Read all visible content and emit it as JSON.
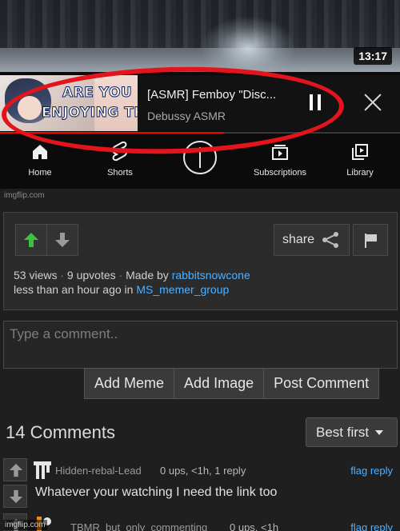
{
  "video": {
    "duration": "13:17"
  },
  "miniplayer": {
    "thumbnail_text_line1": "ARE YOU",
    "thumbnail_text_line2": "ENJOYING THIS?",
    "title": "[ASMR] Femboy \"Disc...",
    "channel": "Debussy ASMR",
    "progress_fraction": 0.56,
    "progress_color": "#ff0000",
    "highlight_color": "#e3141b"
  },
  "bottom_nav": {
    "items": [
      {
        "label": "Home",
        "icon": "home-icon"
      },
      {
        "label": "Shorts",
        "icon": "shorts-icon"
      },
      {
        "label": "",
        "icon": "create-plus-icon"
      },
      {
        "label": "Subscriptions",
        "icon": "subscriptions-icon"
      },
      {
        "label": "Library",
        "icon": "library-icon"
      }
    ]
  },
  "watermark": "imgflip.com",
  "post": {
    "share_label": "share",
    "views": "53 views",
    "upvotes": "9 upvotes",
    "made_by_prefix": "Made by",
    "author": "rabbitsnowcone",
    "time_prefix": "less than an hour ago in",
    "stream": "MS_memer_group",
    "upvote_color": "#3fbf3f",
    "link_color": "#4fb0ff"
  },
  "comment_form": {
    "placeholder": "Type a comment..",
    "add_meme": "Add Meme",
    "add_image": "Add Image",
    "post_comment": "Post Comment"
  },
  "comments_header": {
    "count": "14 Comments",
    "sort": "Best first"
  },
  "comments": [
    {
      "author": "Hidden-rebal-Lead",
      "meta": "0 ups, <1h, 1 reply",
      "flag": "flag",
      "reply": "reply",
      "text": "Whatever your watching I need the link too"
    },
    {
      "author": "TBMR_but_only_commenting",
      "meta": "0 ups, <1h",
      "flag": "flag",
      "reply": "reply",
      "text": ""
    }
  ],
  "footer_watermark": "imgflip.com"
}
